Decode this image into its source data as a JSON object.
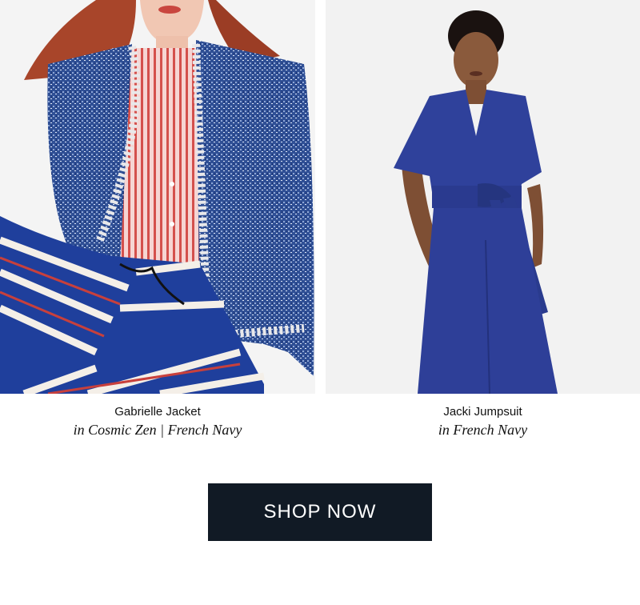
{
  "products": [
    {
      "name": "Gabrielle Jacket",
      "variant": "in Cosmic Zen | French Navy",
      "image_icon": "model-tweed-jacket-photo"
    },
    {
      "name": "Jacki Jumpsuit",
      "variant": "in French Navy",
      "image_icon": "model-jumpsuit-photo"
    }
  ],
  "cta": {
    "label": "SHOP NOW"
  },
  "colors": {
    "button_bg": "#111a25",
    "button_text": "#ffffff",
    "text": "#111111",
    "jacket_navy": "#2c4a8c",
    "jumpsuit_blue": "#2e3f98",
    "stripe_red": "#c8403c"
  }
}
